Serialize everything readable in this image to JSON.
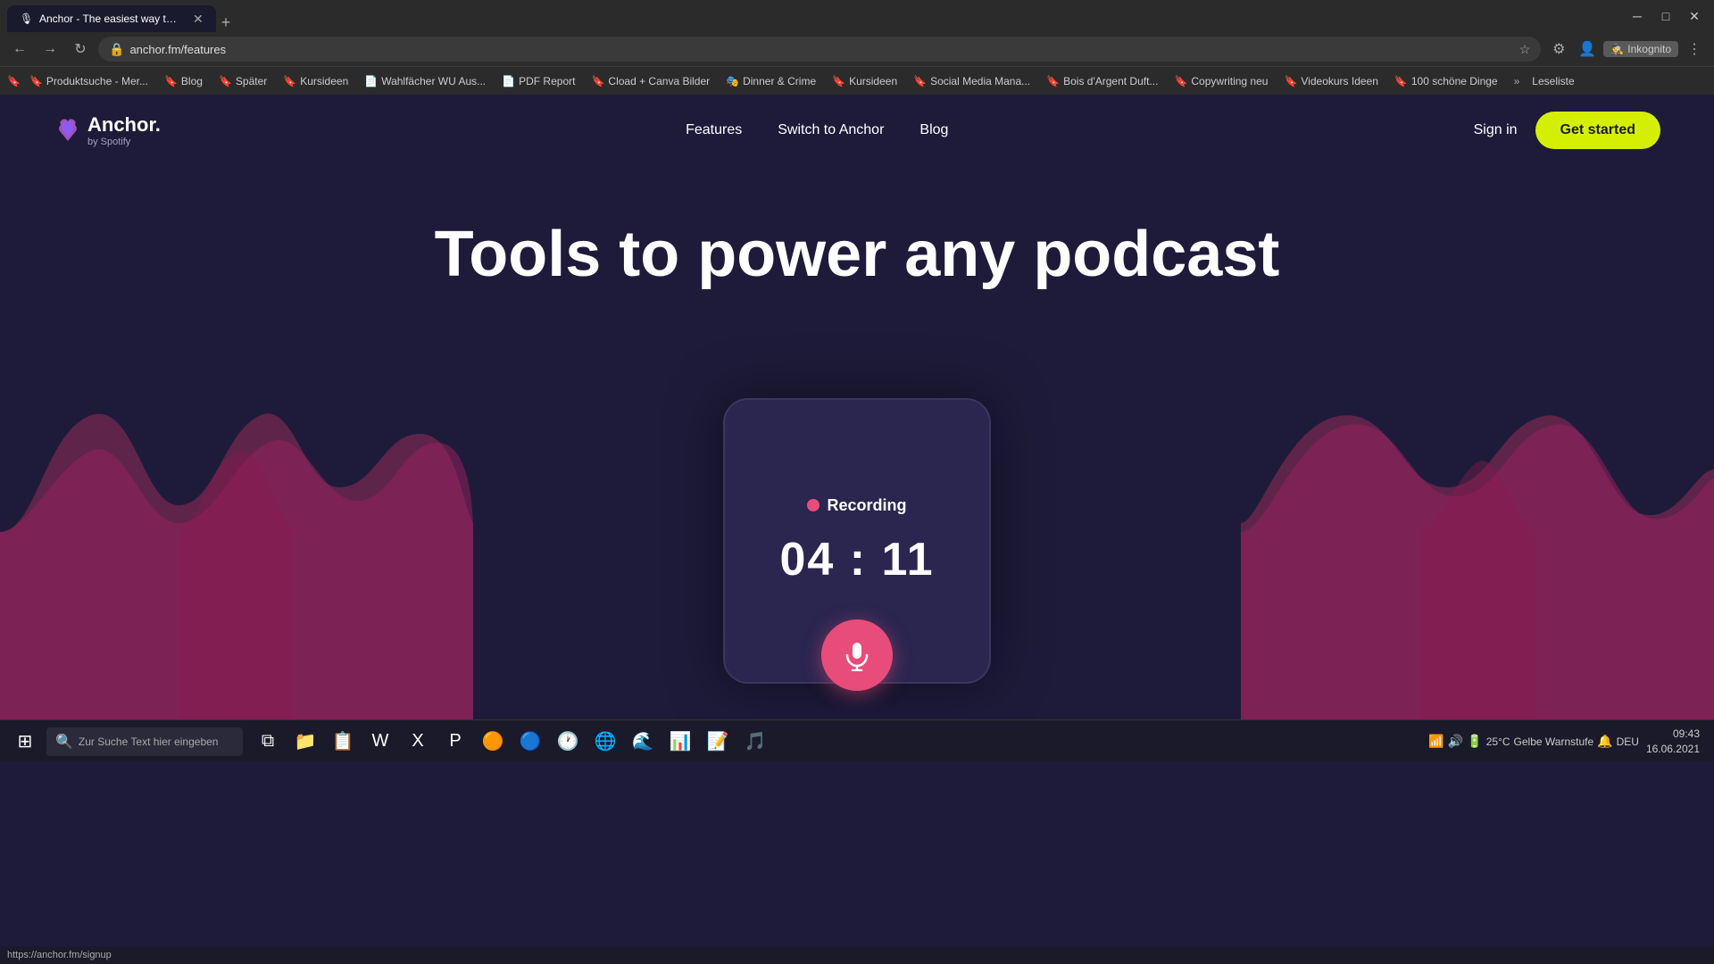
{
  "browser": {
    "tab": {
      "title": "Anchor - The easiest way to ma...",
      "favicon": "🎙"
    },
    "address": "anchor.fm/features",
    "incognito_label": "Inkognito"
  },
  "bookmarks": [
    {
      "label": "Produktsuche - Mer...",
      "icon": "🔖"
    },
    {
      "label": "Blog",
      "icon": "🔖"
    },
    {
      "label": "Später",
      "icon": "🔖"
    },
    {
      "label": "Kursideen",
      "icon": "🔖"
    },
    {
      "label": "Wahlfächer WU Aus...",
      "icon": "📄"
    },
    {
      "label": "PDF Report",
      "icon": "📄"
    },
    {
      "label": "Cload + Canva Bilder",
      "icon": "🔖"
    },
    {
      "label": "Dinner & Crime",
      "icon": "🎭"
    },
    {
      "label": "Kursideen",
      "icon": "🔖"
    },
    {
      "label": "Social Media Mana...",
      "icon": "🔖"
    },
    {
      "label": "Bois d'Argent Duft...",
      "icon": "🔖"
    },
    {
      "label": "Copywriting neu",
      "icon": "🔖"
    },
    {
      "label": "Videokurs Ideen",
      "icon": "🔖"
    },
    {
      "label": "100 schöne Dinge",
      "icon": "🔖"
    }
  ],
  "nav": {
    "logo_text": "Anchor.",
    "logo_by": "by Spotify",
    "links": [
      {
        "label": "Features",
        "href": "#"
      },
      {
        "label": "Switch to Anchor",
        "href": "#"
      },
      {
        "label": "Blog",
        "href": "#"
      }
    ],
    "sign_in": "Sign in",
    "get_started": "Get started"
  },
  "hero": {
    "title": "Tools to power any podcast"
  },
  "recording": {
    "status": "Recording",
    "timer": "04 : 11"
  },
  "taskbar": {
    "search_placeholder": "Zur Suche Text hier eingeben",
    "system": {
      "temp": "25°C",
      "warning": "Gelbe Warnstufe",
      "language": "DEU",
      "time": "09:43",
      "date": "16.06.2021"
    }
  },
  "statusbar": {
    "url": "https://anchor.fm/signup"
  }
}
